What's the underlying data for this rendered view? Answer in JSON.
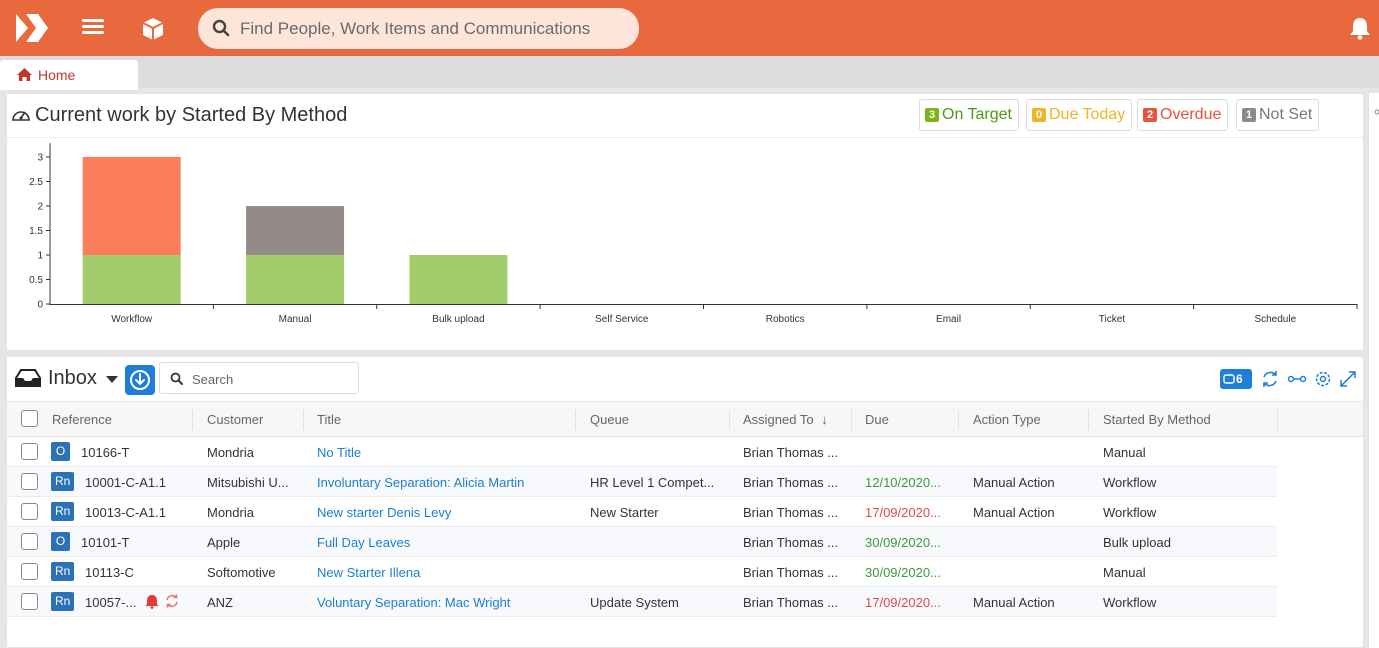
{
  "search": {
    "placeholder": "Find People, Work Items and Communications"
  },
  "tab": {
    "home_label": "Home"
  },
  "chart_panel": {
    "title": "Current work by Started By Method",
    "legend": [
      {
        "count": "3",
        "label": "On Target",
        "color": "#7cb518"
      },
      {
        "count": "0",
        "label": "Due Today",
        "color": "#f0b429"
      },
      {
        "count": "2",
        "label": "Overdue",
        "color": "#e8553d"
      },
      {
        "count": "1",
        "label": "Not Set",
        "color": "#8a8a8a"
      }
    ]
  },
  "chart_data": {
    "type": "bar",
    "stacked": true,
    "categories": [
      "Workflow",
      "Manual",
      "Bulk upload",
      "Self Service",
      "Robotics",
      "Email",
      "Ticket",
      "Schedule"
    ],
    "series": [
      {
        "name": "On Target",
        "color": "#a3cc6b",
        "values": [
          1,
          1,
          1,
          0,
          0,
          0,
          0,
          0
        ]
      },
      {
        "name": "Overdue",
        "color": "#fc7d5a",
        "values": [
          2,
          0,
          0,
          0,
          0,
          0,
          0,
          0
        ]
      },
      {
        "name": "Not Set",
        "color": "#948b89",
        "values": [
          0,
          1,
          0,
          0,
          0,
          0,
          0,
          0
        ]
      }
    ],
    "yticks": [
      "0",
      "0.5",
      "1",
      "1.5",
      "2",
      "2.5",
      "3"
    ],
    "ylim": [
      0,
      3.2
    ],
    "grid": false
  },
  "inbox": {
    "title": "Inbox",
    "search_placeholder": "Search",
    "count": "6",
    "columns": [
      "Reference",
      "Customer",
      "Title",
      "Queue",
      "Assigned To",
      "Due",
      "Action Type",
      "Started By Method"
    ],
    "sort_indicator": "↓",
    "rows": [
      {
        "type": "O",
        "reference": "10166-T",
        "customer": "Mondria",
        "title": "No Title",
        "queue": "",
        "assigned": "Brian Thomas ...",
        "due": "",
        "due_state": "",
        "action_type": "",
        "method": "Manual"
      },
      {
        "type": "Rn",
        "reference": "10001-C-A1.1",
        "customer": "Mitsubishi U...",
        "title": "Involuntary Separation: Alicia Martin",
        "queue": "HR Level 1 Compet...",
        "assigned": "Brian Thomas ...",
        "due": "12/10/2020...",
        "due_state": "green",
        "action_type": "Manual Action",
        "method": "Workflow"
      },
      {
        "type": "Rn",
        "reference": "10013-C-A1.1",
        "customer": "Mondria",
        "title": "New starter Denis Levy",
        "queue": "New Starter",
        "assigned": "Brian Thomas ...",
        "due": "17/09/2020...",
        "due_state": "red",
        "action_type": "Manual Action",
        "method": "Workflow"
      },
      {
        "type": "O",
        "reference": "10101-T",
        "customer": "Apple",
        "title": "Full Day Leaves",
        "queue": "",
        "assigned": "Brian Thomas ...",
        "due": "30/09/2020...",
        "due_state": "green",
        "action_type": "",
        "method": "Bulk upload"
      },
      {
        "type": "Rn",
        "reference": "10113-C",
        "customer": "Softomotive",
        "title": "New Starter Illena",
        "queue": "",
        "assigned": "Brian Thomas ...",
        "due": "30/09/2020...",
        "due_state": "green",
        "action_type": "",
        "method": "Manual"
      },
      {
        "type": "Rn",
        "reference": "10057-...",
        "customer": "ANZ",
        "title": "Voluntary Separation: Mac Wright",
        "queue": "Update System",
        "assigned": "Brian Thomas ...",
        "due": "17/09/2020...",
        "due_state": "red",
        "action_type": "Manual Action",
        "method": "Workflow",
        "flags": [
          "alarm-icon",
          "refresh-icon"
        ]
      }
    ]
  }
}
